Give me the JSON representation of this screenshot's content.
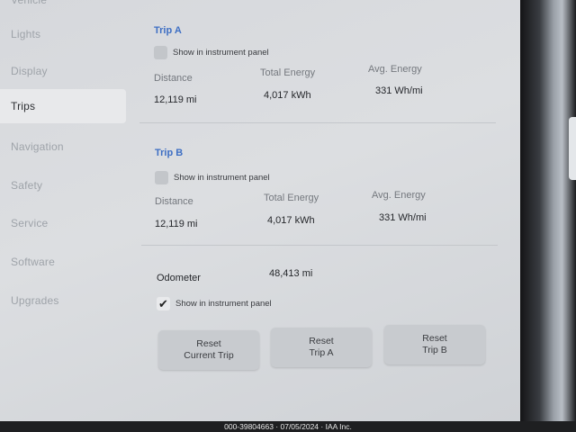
{
  "sidebar": {
    "items": [
      {
        "label": "Vehicle"
      },
      {
        "label": "Lights"
      },
      {
        "label": "Display"
      },
      {
        "label": "Trips"
      },
      {
        "label": "Navigation"
      },
      {
        "label": "Safety"
      },
      {
        "label": "Service"
      },
      {
        "label": "Software"
      },
      {
        "label": "Upgrades"
      }
    ],
    "active": "Trips"
  },
  "trip_a": {
    "title": "Trip A",
    "show_label": "Show in instrument panel",
    "show_checked": false,
    "distance_label": "Distance",
    "distance_value": "12,119  mi",
    "energy_label": "Total Energy",
    "energy_value": "4,017  kWh",
    "avg_label": "Avg. Energy",
    "avg_value": "331  Wh/mi"
  },
  "trip_b": {
    "title": "Trip B",
    "show_label": "Show in instrument panel",
    "show_checked": false,
    "distance_label": "Distance",
    "distance_value": "12,119  mi",
    "energy_label": "Total Energy",
    "energy_value": "4,017  kWh",
    "avg_label": "Avg. Energy",
    "avg_value": "331  Wh/mi"
  },
  "odometer": {
    "label": "Odometer",
    "value": "48,413  mi",
    "show_label": "Show in instrument panel",
    "show_checked": true,
    "check_glyph": "✔"
  },
  "buttons": {
    "reset_current": [
      "Reset",
      "Current Trip"
    ],
    "reset_a": [
      "Reset",
      "Trip A"
    ],
    "reset_b": [
      "Reset",
      "Trip B"
    ]
  },
  "footer": {
    "text": "000-39804663 · 07/05/2024 · IAA Inc."
  },
  "colors": {
    "accent": "#3e6fc4",
    "screen": "#d6d8dc"
  }
}
